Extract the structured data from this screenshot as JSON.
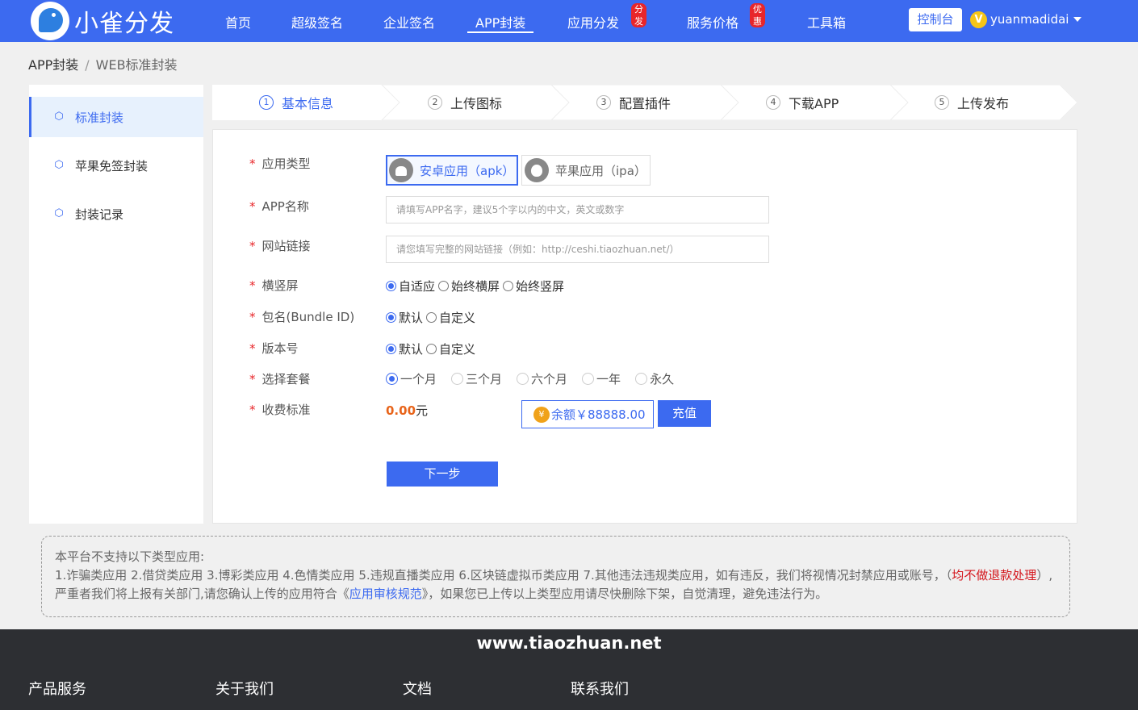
{
  "brand": {
    "name": "小雀分发"
  },
  "nav": {
    "items": [
      {
        "label": "首页"
      },
      {
        "label": "超级签名"
      },
      {
        "label": "企业签名"
      },
      {
        "label": "APP封装"
      },
      {
        "label": "应用分发"
      },
      {
        "label": "服务价格"
      },
      {
        "label": "工具箱"
      }
    ],
    "badge_distribution": "分发",
    "badge_pricing": "优惠",
    "console": "控制台",
    "user_initial": "V",
    "username": "yuanmadidai"
  },
  "breadcrumb": {
    "parent": "APP封装",
    "separator": "/",
    "current": "WEB标准封装"
  },
  "sidebar": {
    "items": [
      {
        "label": "标准封装"
      },
      {
        "label": "苹果免签封装"
      },
      {
        "label": "封装记录"
      }
    ]
  },
  "steps": [
    {
      "num": "1",
      "label": "基本信息"
    },
    {
      "num": "2",
      "label": "上传图标"
    },
    {
      "num": "3",
      "label": "配置插件"
    },
    {
      "num": "4",
      "label": "下载APP"
    },
    {
      "num": "5",
      "label": "上传发布"
    }
  ],
  "form": {
    "required_mark": "*",
    "app_type": {
      "label": "应用类型",
      "android": "安卓应用（apk）",
      "ios": "苹果应用（ipa）"
    },
    "app_name": {
      "label": "APP名称",
      "placeholder": "请填写APP名字，建议5个字以内的中文，英文或数字"
    },
    "site_url": {
      "label": "网站链接",
      "placeholder": "请您填写完整的网站链接（例如：http://ceshi.tiaozhuan.net/）"
    },
    "orientation": {
      "label": "横竖屏",
      "options": [
        "自适应",
        "始终横屏",
        "始终竖屏"
      ]
    },
    "bundle_id": {
      "label": "包名(Bundle ID)",
      "options": [
        "默认",
        "自定义"
      ]
    },
    "version": {
      "label": "版本号",
      "options": [
        "默认",
        "自定义"
      ]
    },
    "package": {
      "label": "选择套餐",
      "options": [
        "一个月",
        "三个月",
        "六个月",
        "一年",
        "永久"
      ]
    },
    "fee": {
      "label": "收费标准",
      "amount": "0.00",
      "unit": "元"
    },
    "balance": {
      "coin": "¥",
      "text": "余额￥88888.00"
    },
    "recharge": "充值",
    "next": "下一步"
  },
  "notice": {
    "title": "本平台不支持以下类型应用:",
    "body1": "1.诈骗类应用 2.借贷类应用 3.博彩类应用 4.色情类应用 5.违规直播类应用 6.区块链虚拟币类应用 7.其他违法违规类应用，如有违反，我们将视情况封禁应用或账号，（",
    "red": "均不做退款处理",
    "body2": "）,严重者我们将上报有关部门,请您确认上传的应用符合《",
    "link": "应用审核规范",
    "body3": "》，如果您已上传以上类型应用请尽快删除下架，自觉清理，避免违法行为。"
  },
  "footer": {
    "site": "www.tiaozhuan.net",
    "cols": [
      "产品服务",
      "关于我们",
      "文档",
      "联系我们"
    ]
  },
  "colors": {
    "primary": "#3c6af0",
    "danger": "#e8262a",
    "fee": "#e8641a",
    "footer": "#2d2f33"
  }
}
